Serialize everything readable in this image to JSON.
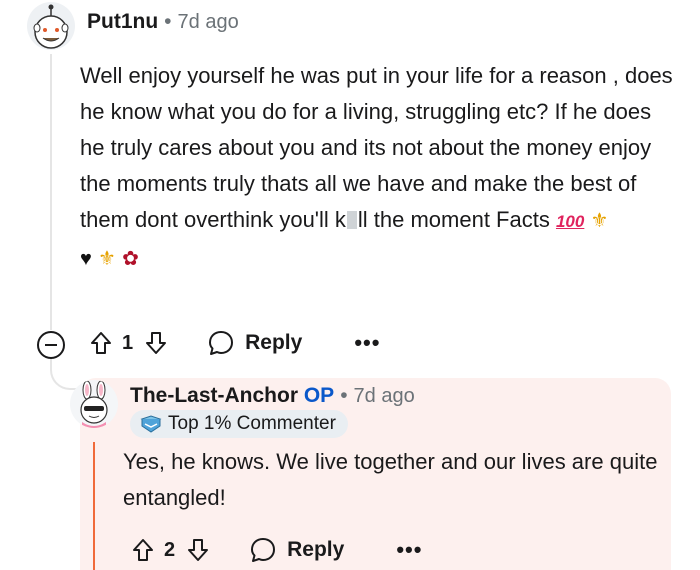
{
  "comment1": {
    "username": "Put1nu",
    "separator": "•",
    "time": "7d ago",
    "body_before": "Well enjoy yourself he was put in your life for a reason , does he know what you do for a living, struggling etc? If he does he truly cares about you and its not about the money enjoy the moments truly thats all we have and make the best of them dont overthink you'll k",
    "body_after": "ll the moment Facts ",
    "emoji_100": "100",
    "upvotes": "1",
    "reply_label": "Reply",
    "more_label": "•••"
  },
  "comment2": {
    "username": "The-Last-Anchor",
    "op_label": "OP",
    "separator": "•",
    "time": "7d ago",
    "badge": "Top 1% Commenter",
    "body": "Yes, he knows. We live together and our lives are quite entangled!",
    "upvotes": "2",
    "reply_label": "Reply",
    "more_label": "•••"
  },
  "icons": {
    "upvote": "upvote-arrow-icon",
    "downvote": "downvote-arrow-icon",
    "reply": "speech-bubble-icon",
    "collapse": "collapse-minus-icon",
    "badge": "commenter-badge-icon"
  },
  "colors": {
    "op_blue": "#0a58ca",
    "op_line": "#f06a3a",
    "reply_bg": "#fdf0ee",
    "meta_gray": "#6b7277"
  }
}
